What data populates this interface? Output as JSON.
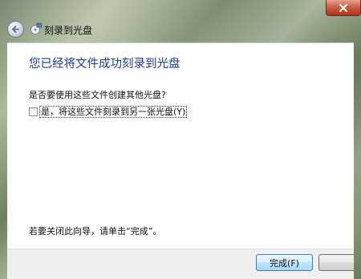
{
  "window": {
    "title": "刻录到光盘",
    "title_icon": "burn-disc-icon",
    "back_icon": "back-arrow-icon",
    "close_icon": "close-icon",
    "close_color": "#c75b42"
  },
  "main": {
    "heading": "您已经将文件成功刻录到光盘",
    "question": "是否要使用这些文件创建其他光盘?",
    "option_label": "是，将这些文件刻录到另一张光盘(Y)",
    "option_checked": false,
    "hint": "若要关闭此向导，请单击“完成”。"
  },
  "footer": {
    "finish_label": "完成(F)"
  }
}
